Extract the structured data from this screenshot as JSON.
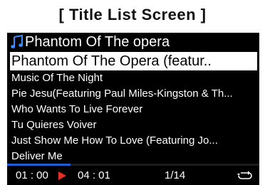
{
  "caption": "[ Title List Screen ]",
  "header": {
    "icon": "music-note-icon",
    "title": "Phantom Of The opera"
  },
  "selected_track": "Phantom Of The Opera (featur..",
  "tracks": [
    "Music Of The Night",
    "Pie Jesu(Featuring Paul Miles-Kingston & Th...",
    "Who Wants To Live Forever",
    "Tu Quieres Voiver",
    "Just Show Me How To Love (Featuring Jo...",
    "Deliver Me"
  ],
  "status": {
    "elapsed": "01 : 00",
    "total": "04 : 01",
    "index": "1/14",
    "progress": 0.25,
    "play_icon": "play-icon",
    "repeat_icon": "repeat-icon"
  },
  "colors": {
    "screen_bg": "#000000",
    "accent_blue": "#1f5fd6",
    "play_red": "#e53021",
    "note_blue": "#3a8cff"
  }
}
